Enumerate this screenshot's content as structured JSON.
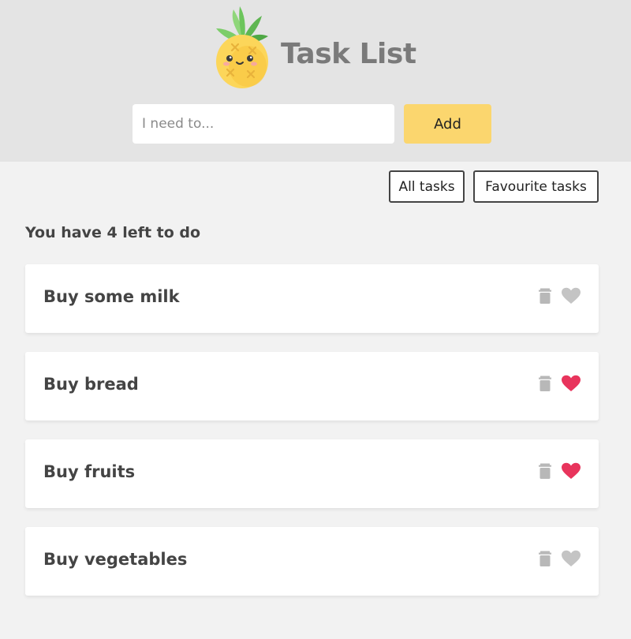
{
  "header": {
    "title": "Task List",
    "logo_icon": "pineapple-icon"
  },
  "form": {
    "input_placeholder": "I need to...",
    "input_value": "",
    "add_label": "Add"
  },
  "filters": {
    "all_label": "All tasks",
    "favourite_label": "Favourite tasks"
  },
  "summary": {
    "remaining_text": "You have 4 left to do"
  },
  "tasks": [
    {
      "title": "Buy some milk",
      "favourite": false
    },
    {
      "title": "Buy bread",
      "favourite": true
    },
    {
      "title": "Buy fruits",
      "favourite": true
    },
    {
      "title": "Buy vegetables",
      "favourite": false
    }
  ],
  "icons": {
    "delete": "trash-icon",
    "favourite": "heart-icon"
  },
  "colors": {
    "header_bg": "#e4e4e4",
    "page_bg": "#f2f2f2",
    "accent_button": "#fbd66e",
    "heart_active": "#e8345c",
    "heart_inactive": "#c4c4c4",
    "trash": "#b8b8b8"
  }
}
